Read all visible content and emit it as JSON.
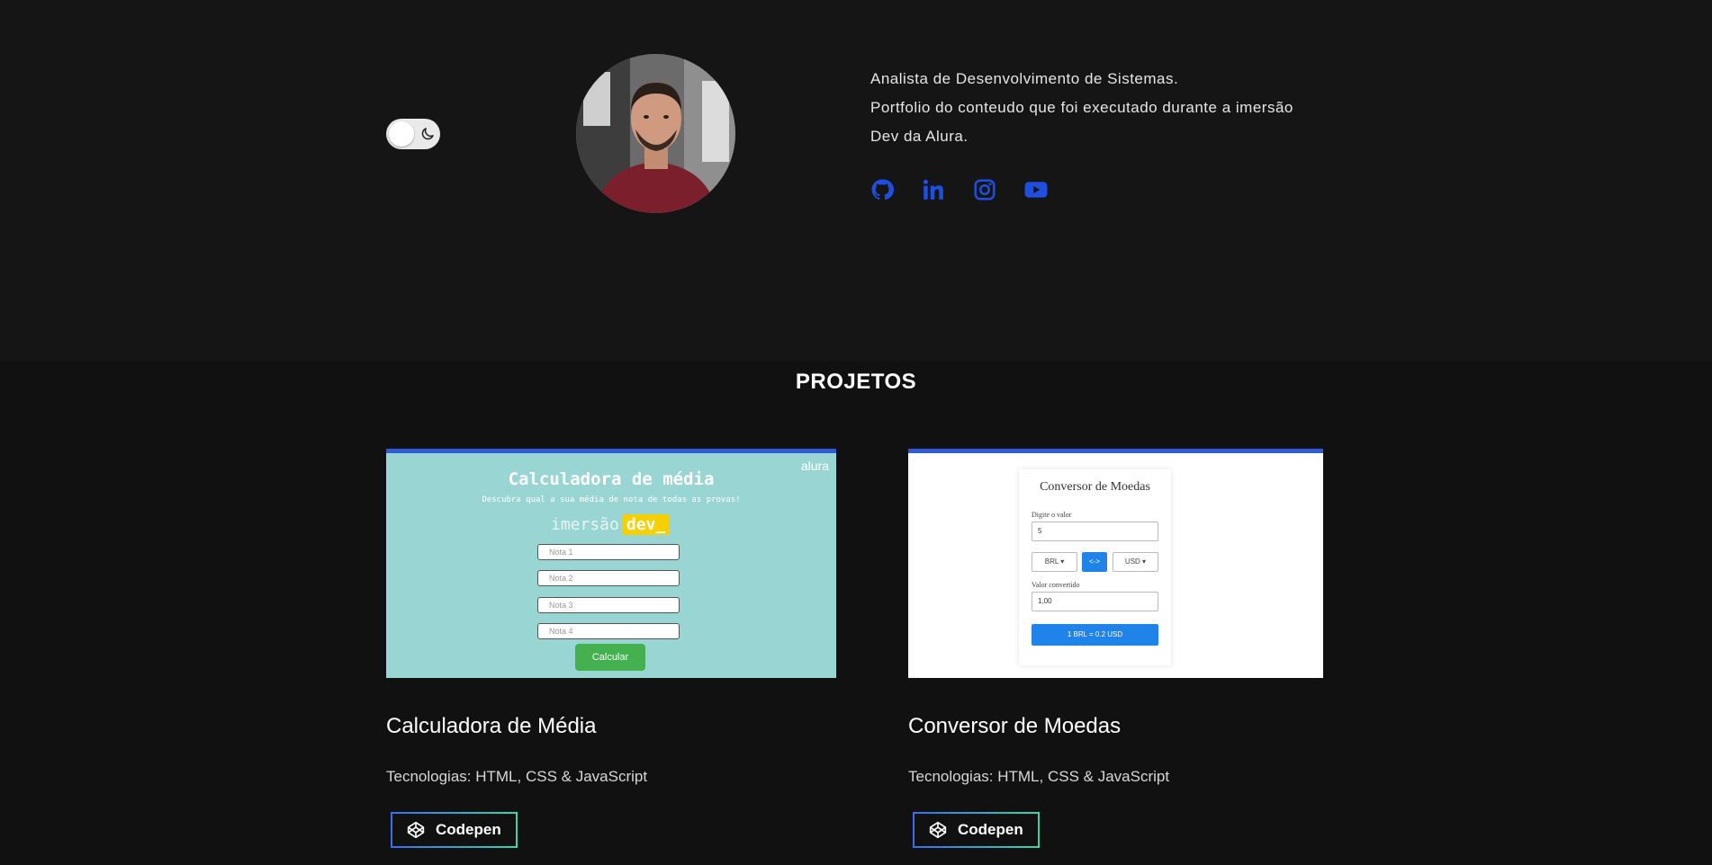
{
  "header": {
    "theme_toggle": {
      "icon": "moon-icon",
      "state": "off"
    },
    "avatar": {
      "alt": ""
    },
    "bio": {
      "line1": "Analista de Desenvolvimento de Sistemas.",
      "line2": "Portfolio do conteudo que foi executado durante a imersão",
      "line3": "Dev da Alura."
    },
    "social": [
      {
        "icon": "github-icon"
      },
      {
        "icon": "linkedin-icon"
      },
      {
        "icon": "instagram-icon"
      },
      {
        "icon": "youtube-icon"
      }
    ],
    "accent_color": "#1f4fe0"
  },
  "projects": {
    "title": "PROJETOS",
    "items": [
      {
        "name": "Calculadora de Média",
        "tech": "Tecnologias: HTML, CSS & JavaScript",
        "button": "Codepen",
        "thumb": {
          "brand": "alura",
          "title": "Calculadora de média",
          "subtitle": "Descubra qual a sua média de nota de todas as provas!",
          "logo_left": "imersão",
          "logo_right": "dev_",
          "fields": [
            "Nota 1",
            "Nota 2",
            "Nota 3",
            "Nota 4"
          ],
          "button": "Calcular"
        }
      },
      {
        "name": "Conversor de Moedas",
        "tech": "Tecnologias: HTML, CSS & JavaScript",
        "button": "Codepen",
        "thumb": {
          "title": "Conversor de Moedas",
          "input_label": "Digite o valor",
          "input_value": "5",
          "from": "BRL ▾",
          "swap": "<->",
          "to": "USD ▾",
          "output_label": "Valor convertido",
          "output_value": "1,00",
          "result": "1 BRL = 0.2 USD"
        }
      }
    ]
  }
}
